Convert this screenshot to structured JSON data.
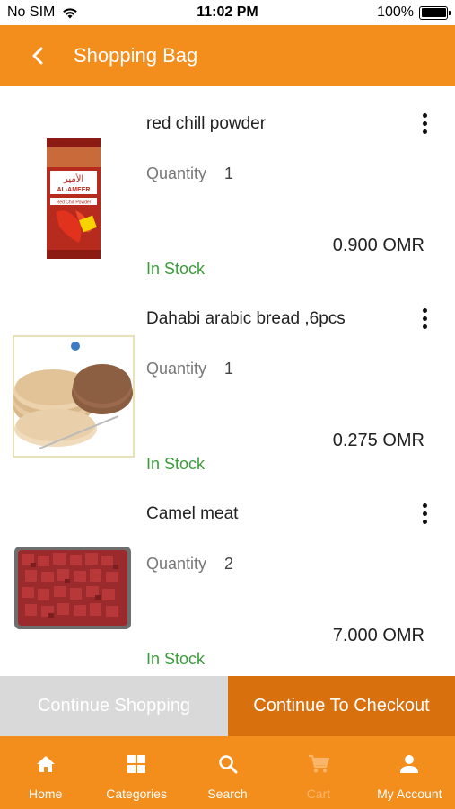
{
  "status_bar": {
    "carrier": "No SIM",
    "time": "11:02 PM",
    "battery": "100%"
  },
  "header": {
    "title": "Shopping Bag"
  },
  "items": [
    {
      "name": "red chill powder",
      "quantity_label": "Quantity",
      "quantity": "1",
      "price": "0.900 OMR",
      "stock": "In Stock"
    },
    {
      "name": "Dahabi arabic bread ,6pcs",
      "quantity_label": "Quantity",
      "quantity": "1",
      "price": "0.275 OMR",
      "stock": "In Stock"
    },
    {
      "name": "Camel meat",
      "quantity_label": "Quantity",
      "quantity": "2",
      "price": "7.000 OMR",
      "stock": "In Stock"
    }
  ],
  "product_labels": {
    "brand": "AL-AMEER",
    "brand_arabic": "الأمير",
    "product": "Red Chili Powder"
  },
  "actions": {
    "continue_shopping": "Continue Shopping",
    "checkout": "Continue To Checkout"
  },
  "tabbar": {
    "home": "Home",
    "categories": "Categories",
    "search": "Search",
    "cart": "Cart",
    "account": "My Account"
  },
  "colors": {
    "brand_orange": "#f38d1c",
    "checkout_orange": "#d8700e",
    "in_stock_green": "#3a9d3a",
    "disabled_gray": "#d9d9d9"
  }
}
